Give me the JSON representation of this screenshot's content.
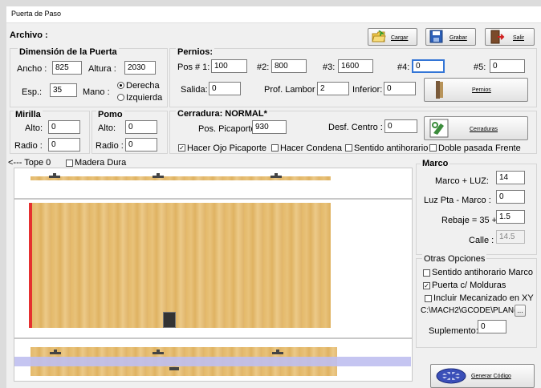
{
  "window": {
    "title": "Puerta de Paso"
  },
  "menu": {
    "archivo": "Archivo :"
  },
  "toolbar": {
    "cargar": "Cargar",
    "grabar": "Grabar",
    "salir": "Salir"
  },
  "dimension": {
    "title": "Dimensión de la Puerta",
    "ancho_label": "Ancho :",
    "ancho": "825",
    "altura_label": "Altura :",
    "altura": "2030",
    "esp_label": "Esp.:",
    "esp": "35",
    "mano_label": "Mano :",
    "derecha": "Derecha",
    "izquierda": "Izquierda"
  },
  "pernios": {
    "title": "Pernios:",
    "pos1_label": "Pos # 1:",
    "pos1": "100",
    "pos2_label": "#2:",
    "pos2": "800",
    "pos3_label": "#3:",
    "pos3": "1600",
    "pos4_label": "#4:",
    "pos4": "0",
    "pos5_label": "#5:",
    "pos5": "0",
    "salida_label": "Salida:",
    "salida": "0",
    "lambor_label": "Prof. Lambor :",
    "lambor": "2",
    "inferior_label": "Inferior:",
    "inferior": "0",
    "button": "Pernios"
  },
  "mirilla": {
    "title": "Mirilla",
    "alto_label": "Alto:",
    "alto": "0",
    "radio_label": "Radio :",
    "radio": "0"
  },
  "pomo": {
    "title": "Pomo",
    "alto_label": "Alto:",
    "alto": "0",
    "radio_label": "Radio :",
    "radio": "0"
  },
  "cerradura": {
    "title": "Cerradura: NORMAL*",
    "picaporte_label": "Pos. Picaporte",
    "picaporte": "930",
    "desf_label": "Desf. Centro :",
    "desf": "0",
    "button": "Cerraduras",
    "ojo": "Hacer Ojo Picaporte",
    "condena": "Hacer Condena",
    "antihorario": "Sentido antihorario",
    "doble": "Doble pasada Frente"
  },
  "preview": {
    "tope": "<--- Tope 0",
    "madera": "Madera Dura"
  },
  "marco": {
    "title": "Marco",
    "luz_label": "Marco + LUZ:",
    "luz": "14",
    "luzpta_label": "Luz Pta - Marco :",
    "luzpta": "0",
    "rebaje_label": "Rebaje =  35 +",
    "rebaje": "1.5",
    "calle_label": "Calle :",
    "calle": "14.5"
  },
  "otras": {
    "title": "Otras Opciones",
    "antihorario": "Sentido antihorario Marco",
    "molduras": "Puerta c/ Molduras",
    "xy": "Incluir Mecanizado en XY",
    "path": "C:\\MACH2\\GCODE\\PLAN(",
    "browse": "...",
    "suplemento_label": "Suplemento:",
    "suplemento": "0"
  },
  "generar": {
    "label": "Generar Código"
  }
}
